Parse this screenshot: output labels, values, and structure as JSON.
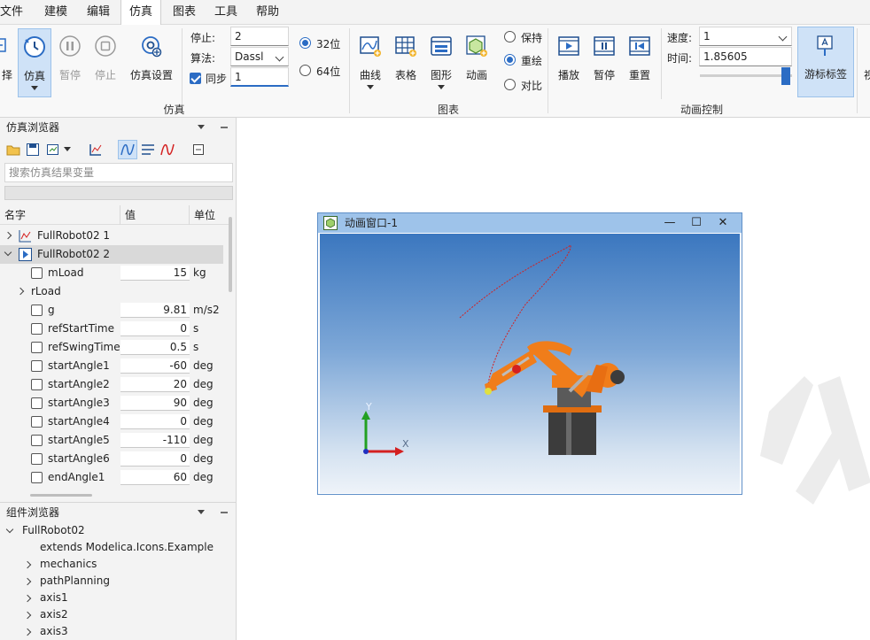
{
  "menu": {
    "file": "文件",
    "build": "建模",
    "edit": "编辑",
    "simulate": "仿真",
    "chart": "图表",
    "tools": "工具",
    "help": "帮助"
  },
  "ribbon": {
    "buttons": {
      "select": "择",
      "simulate": "仿真",
      "pause": "暂停",
      "stop": "停止",
      "sim_settings": "仿真设置",
      "curve": "曲线",
      "table": "表格",
      "graph": "图形",
      "animation": "动画",
      "play": "播放",
      "anim_pause": "暂停",
      "reset": "重置",
      "cursor_label": "游标标签",
      "more": "视"
    },
    "sim_params": {
      "stop_label": "停止:",
      "stop_value": "2",
      "algo_label": "算法:",
      "algo_value": "Dassl",
      "sync_label": "同步",
      "sync_value": "1",
      "bit32": "32位",
      "bit64": "64位"
    },
    "chart_opts": {
      "keep": "保持",
      "redraw": "重绘",
      "compare": "对比"
    },
    "anim_params": {
      "speed_label": "速度:",
      "speed_value": "1",
      "time_label": "时间:",
      "time_value": "1.85605",
      "slider_fraction": 0.93
    },
    "groups": {
      "sim": "仿真",
      "chart": "图表",
      "anim": "动画控制"
    }
  },
  "sim_browser": {
    "title": "仿真浏览器",
    "search_placeholder": "搜索仿真结果变量",
    "columns": {
      "name": "名字",
      "value": "值",
      "unit": "单位"
    },
    "results": [
      "FullRobot02 1",
      "FullRobot02 2"
    ],
    "rows": [
      {
        "name": "mLoad",
        "value": "15",
        "unit": "kg"
      },
      {
        "name": "rLoad",
        "value": "",
        "unit": ""
      },
      {
        "name": "g",
        "value": "9.81",
        "unit": "m/s2"
      },
      {
        "name": "refStartTime",
        "value": "0",
        "unit": "s"
      },
      {
        "name": "refSwingTime",
        "value": "0.5",
        "unit": "s"
      },
      {
        "name": "startAngle1",
        "value": "-60",
        "unit": "deg"
      },
      {
        "name": "startAngle2",
        "value": "20",
        "unit": "deg"
      },
      {
        "name": "startAngle3",
        "value": "90",
        "unit": "deg"
      },
      {
        "name": "startAngle4",
        "value": "0",
        "unit": "deg"
      },
      {
        "name": "startAngle5",
        "value": "-110",
        "unit": "deg"
      },
      {
        "name": "startAngle6",
        "value": "0",
        "unit": "deg"
      },
      {
        "name": "endAngle1",
        "value": "60",
        "unit": "deg"
      }
    ]
  },
  "component_browser": {
    "title": "组件浏览器",
    "root": "FullRobot02",
    "items": [
      "extends Modelica.Icons.Example",
      "mechanics",
      "pathPlanning",
      "axis1",
      "axis2",
      "axis3"
    ]
  },
  "anim_window": {
    "title": "动画窗口-1",
    "axis_x": "X",
    "axis_y": "Y"
  },
  "colors": {
    "accent": "#2b6cc4",
    "robot_orange": "#f07d1a",
    "trajectory": "#d42020"
  }
}
